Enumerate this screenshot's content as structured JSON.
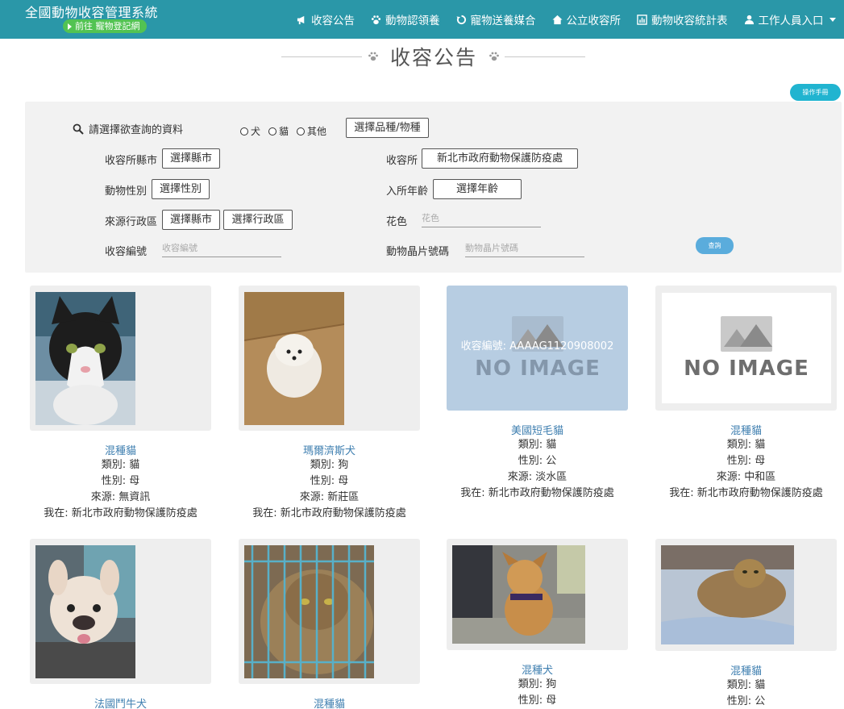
{
  "header": {
    "brand": "全國動物收容管理系統",
    "pet_link": "前往 寵物登記網",
    "nav": [
      {
        "label": "收容公告",
        "icon": "megaphone-icon"
      },
      {
        "label": "動物認領養",
        "icon": "paw-icon"
      },
      {
        "label": "寵物送養媒合",
        "icon": "refresh-icon"
      },
      {
        "label": "公立收容所",
        "icon": "home-icon"
      },
      {
        "label": "動物收容統計表",
        "icon": "chart-icon"
      },
      {
        "label": "工作人員入口",
        "icon": "user-icon"
      }
    ]
  },
  "page": {
    "title": "收容公告",
    "manual_button": "操作手冊"
  },
  "search": {
    "prompt": "請選擇欲查詢的資料",
    "species_options": [
      "犬",
      "貓",
      "其他"
    ],
    "breed_button": "選擇品種/物種",
    "shelter_county_label": "收容所縣市",
    "shelter_county_button": "選擇縣市",
    "shelter_label": "收容所",
    "shelter_value": "新北市政府動物保護防疫處",
    "sex_label": "動物性別",
    "sex_button": "選擇性別",
    "age_label": "入所年齡",
    "age_button": "選擇年齡",
    "origin_label": "來源行政區",
    "origin_county_button": "選擇縣市",
    "origin_district_button": "選擇行政區",
    "color_label": "花色",
    "color_placeholder": "花色",
    "id_label": "收容編號",
    "id_placeholder": "收容編號",
    "chip_label": "動物晶片號碼",
    "chip_placeholder": "動物晶片號碼",
    "query_button": "查詢"
  },
  "animals": [
    {
      "name": "混種貓",
      "kind": "類別: 貓",
      "sex": "性別: 母",
      "source": "來源: 無資訊",
      "location": "我在: 新北市政府動物保護防疫處"
    },
    {
      "name": "瑪爾濟斯犬",
      "kind": "類別: 狗",
      "sex": "性別: 母",
      "source": "來源: 新莊區",
      "location": "我在: 新北市政府動物保護防疫處"
    },
    {
      "name": "美國短毛貓",
      "kind": "類別: 貓",
      "sex": "性別: 公",
      "source": "來源: 淡水區",
      "location": "我在: 新北市政府動物保護防疫處",
      "overlay": "收容編號: AAAAG1120908002",
      "no_image": "NO IMAGE"
    },
    {
      "name": "混種貓",
      "kind": "類別: 貓",
      "sex": "性別: 母",
      "source": "來源: 中和區",
      "location": "我在: 新北市政府動物保護防疫處",
      "no_image": "NO IMAGE"
    },
    {
      "name": "法國鬥牛犬"
    },
    {
      "name": "混種貓"
    },
    {
      "name": "混種犬",
      "kind": "類別: 狗",
      "sex": "性別: 母"
    },
    {
      "name": "混種貓",
      "kind": "類別: 貓",
      "sex": "性別: 公"
    }
  ],
  "colors": {
    "navbar": "#2a97a8",
    "link": "#3f7fb0",
    "accent": "#21b4d0"
  }
}
